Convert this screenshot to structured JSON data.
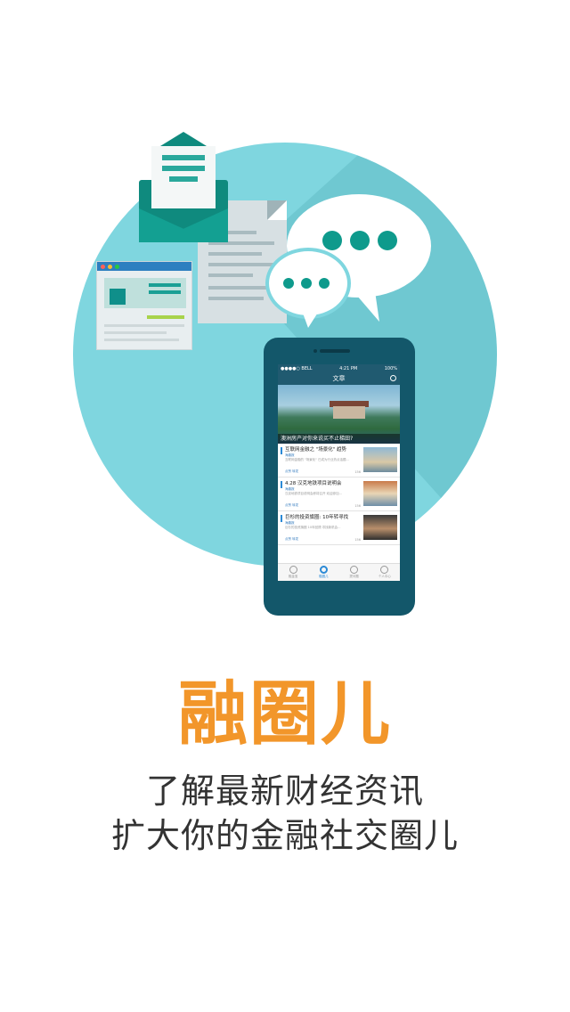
{
  "app": {
    "name": "融圈儿",
    "slogan_line1": "了解最新财经资讯",
    "slogan_line2": "扩大你的金融社交圈儿",
    "accent_color": "#f2962a",
    "circle_color": "#7fd6df"
  },
  "phone_screen": {
    "status": {
      "carrier": "●●●●○ BELL",
      "time": "4:21 PM",
      "battery": "100%"
    },
    "nav_title": "文章",
    "banner_caption": "澳洲房产对你来说买不止梯田?",
    "articles": [
      {
        "title": "互联网金融之 \"场景化\" 趋势",
        "source": "海趣报",
        "excerpt": "互联网金融的 \"场景化\" 已成为行业热点话题...",
        "action": "点赞 转发",
        "views": "156"
      },
      {
        "title": "4.28 汉克地铁项目说明会",
        "source": "海趣报",
        "excerpt": "汉克地铁项目说明会即将召开 欢迎参加...",
        "action": "点赞 转发",
        "views": "156"
      },
      {
        "title": "巨杉的投资旗圈: 10年转寻找",
        "source": "海趣报",
        "excerpt": "巨杉的投资旗圈 10年回顾 寻找新机会...",
        "action": "点赞 转发",
        "views": "156"
      }
    ],
    "tabs": [
      {
        "label": "融金宝",
        "icon": "dollar-icon"
      },
      {
        "label": "融圈儿",
        "icon": "circle-icon"
      },
      {
        "label": "提问题",
        "icon": "question-icon"
      },
      {
        "label": "个人中心",
        "icon": "user-icon"
      }
    ]
  }
}
